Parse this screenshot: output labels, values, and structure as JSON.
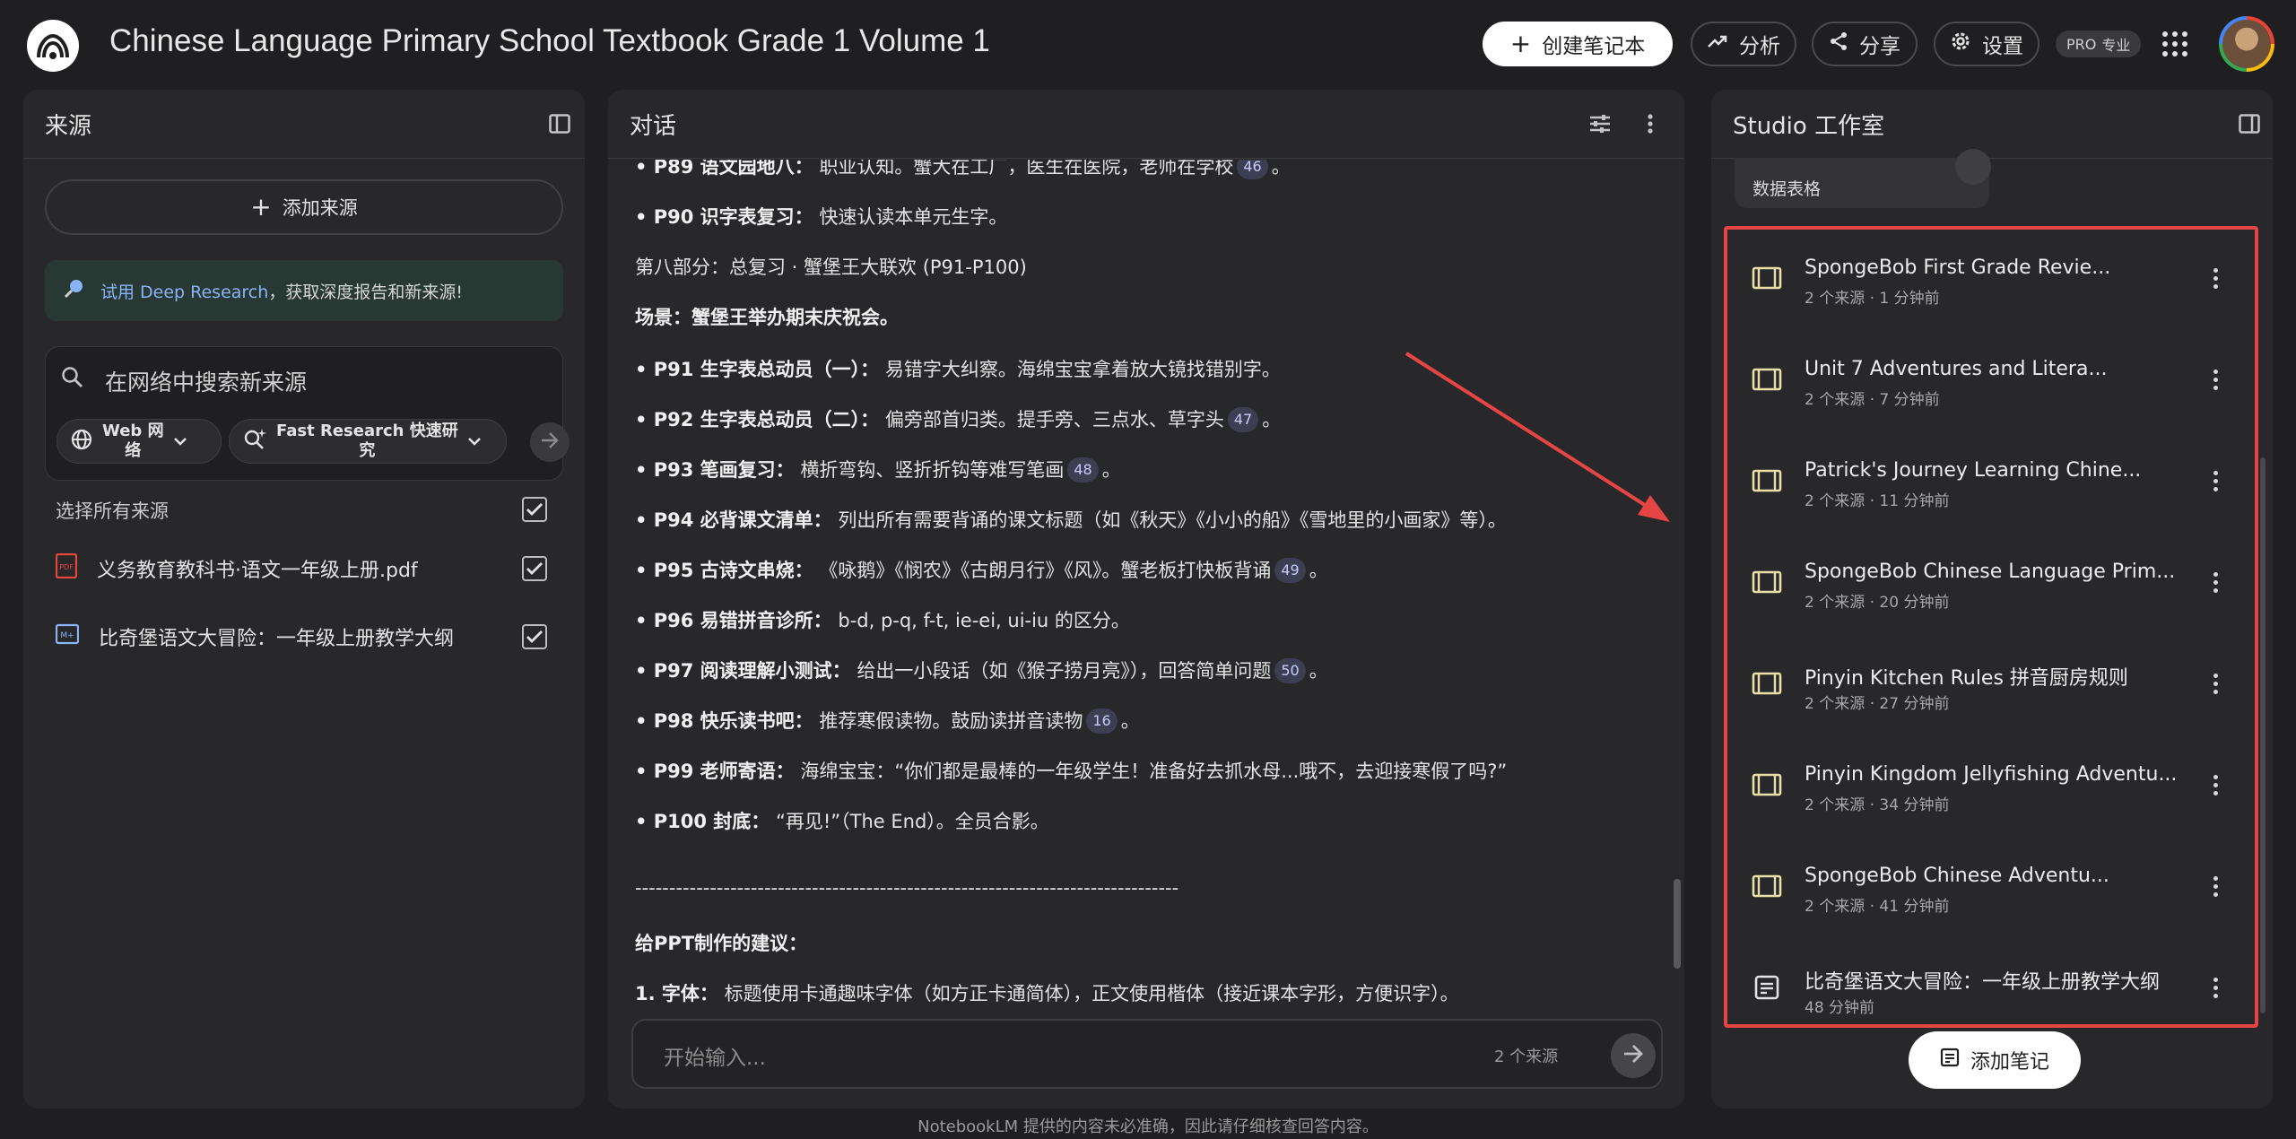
{
  "header": {
    "title": "Chinese Language Primary School Textbook Grade 1 Volume 1",
    "create_label": "创建笔记本",
    "analytics_label": "分析",
    "share_label": "分享",
    "settings_label": "设置",
    "pro_label": "PRO",
    "pro_sub": "专业"
  },
  "sources": {
    "title": "来源",
    "add_label": "添加来源",
    "deep_research_link": "试用 Deep Research",
    "deep_research_rest": "，获取深度报告和新来源!",
    "search_placeholder": "在网络中搜索新来源",
    "web_chip_a": "Web 网",
    "web_chip_b": "络",
    "fast_chip_a": "Fast Research 快速研",
    "fast_chip_b": "究",
    "select_all": "选择所有来源",
    "items": [
      {
        "label": "义务教育教科书·语文一年级上册.pdf",
        "type": "pdf"
      },
      {
        "label": "比奇堡语文大冒险：一年级上册教学大纲",
        "type": "md"
      }
    ]
  },
  "chat": {
    "title": "对话",
    "lines": [
      {
        "bold": "• P89 语文园地八：",
        "text": "职业认知。蟹大在工厂，医生在医院，老师在学校",
        "cite": "46",
        "tail": "。"
      },
      {
        "bold": "• P90 识字表复习：",
        "text": "快速认读本单元生字。",
        "cite": "",
        "tail": ""
      },
      {
        "bold": "",
        "text": "第八部分：总复习 · 蟹堡王大联欢 (P91-P100)",
        "cite": "",
        "tail": ""
      },
      {
        "bold": "场景：蟹堡王举办期末庆祝会。",
        "text": "",
        "cite": "",
        "tail": ""
      },
      {
        "bold": "• P91 生字表总动员（一）：",
        "text": "易错字大纠察。海绵宝宝拿着放大镜找错别字。",
        "cite": "",
        "tail": ""
      },
      {
        "bold": "• P92 生字表总动员（二）：",
        "text": "偏旁部首归类。提手旁、三点水、草字头",
        "cite": "47",
        "tail": "。"
      },
      {
        "bold": "• P93 笔画复习：",
        "text": "横折弯钩、竖折折钩等难写笔画",
        "cite": "48",
        "tail": "。"
      },
      {
        "bold": "• P94 必背课文清单：",
        "text": "列出所有需要背诵的课文标题（如《秋天》《小小的船》《雪地里的小画家》等）。",
        "cite": "",
        "tail": ""
      },
      {
        "bold": "• P95 古诗文串烧：",
        "text": "《咏鹅》《悯农》《古朗月行》《风》。蟹老板打快板背诵",
        "cite": "49",
        "tail": "。"
      },
      {
        "bold": "• P96 易错拼音诊所：",
        "text": "b-d, p-q, f-t, ie-ei, ui-iu 的区分。",
        "cite": "",
        "tail": ""
      },
      {
        "bold": "• P97 阅读理解小测试：",
        "text": "给出一小段话（如《猴子捞月亮》），回答简单问题",
        "cite": "50",
        "tail": "。"
      },
      {
        "bold": "• P98 快乐读书吧：",
        "text": "推荐寒假读物。鼓励读拼音读物",
        "cite": "16",
        "tail": "。"
      },
      {
        "bold": "• P99 老师寄语：",
        "text": "海绵宝宝：“你们都是最棒的一年级学生！准备好去抓水母...哦不，去迎接寒假了吗?”",
        "cite": "",
        "tail": ""
      },
      {
        "bold": "• P100 封底：",
        "text": "“再见!”（The End）。全员合影。",
        "cite": "",
        "tail": ""
      },
      {
        "bold": "",
        "text": "--------------------------------------------------------------------------------",
        "cite": "",
        "tail": ""
      },
      {
        "bold": "给PPT制作的建议：",
        "text": "",
        "cite": "",
        "tail": ""
      },
      {
        "bold": "1. 字体：",
        "text": "标题使用卡通趣味字体（如方正卡通简体），正文使用楷体（接近课本字形，方便识字）。",
        "cite": "",
        "tail": ""
      }
    ],
    "input_placeholder": "开始输入...",
    "source_count": "2 个来源"
  },
  "studio": {
    "title": "Studio 工作室",
    "table_chip": "数据表格",
    "notes": [
      {
        "title": "SpongeBob First Grade Revie...",
        "meta": "2 个来源 · 1 分钟前",
        "icon": "video-icon"
      },
      {
        "title": "Unit 7 Adventures and Litera...",
        "meta": "2 个来源 · 7 分钟前",
        "icon": "video-icon"
      },
      {
        "title": "Patrick's Journey Learning Chine...",
        "meta": "2 个来源 · 11 分钟前",
        "icon": "video-icon"
      },
      {
        "title": "SpongeBob Chinese Language Prim...",
        "meta": "2 个来源 · 20 分钟前",
        "icon": "video-icon"
      },
      {
        "title": "Pinyin Kitchen Rules  拼音厨房规则",
        "meta": "2 个来源 · 27 分钟前",
        "icon": "video-icon"
      },
      {
        "title": "Pinyin Kingdom Jellyfishing Adventu...",
        "meta": "2 个来源 · 34 分钟前",
        "icon": "video-icon"
      },
      {
        "title": "SpongeBob Chinese Adventu...",
        "meta": "2 个来源 · 41 分钟前",
        "icon": "video-icon"
      },
      {
        "title": "比奇堡语文大冒险：一年级上册教学大纲",
        "meta": "48 分钟前",
        "icon": "note-icon"
      }
    ],
    "add_note_label": "添加笔记"
  },
  "footer": {
    "disclaimer": "NotebookLM 提供的内容未必准确，因此请仔细核查回答内容。"
  },
  "colors": {
    "background": "#1f1f21",
    "panel": "#28282b",
    "highlight_box": "#e64545",
    "annotation_arrow": "#e64545",
    "link": "#8ab4f8"
  }
}
